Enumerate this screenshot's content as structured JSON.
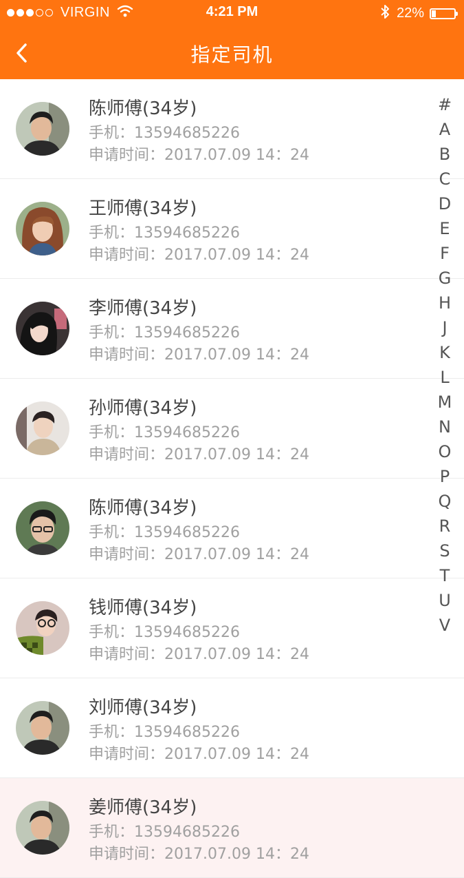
{
  "status_bar": {
    "carrier": "VIRGIN",
    "time": "4:21 PM",
    "battery": "22%",
    "battery_level": 0.22,
    "signal_dots_filled": 3,
    "signal_dots_total": 5
  },
  "nav": {
    "title": "指定司机",
    "back_icon": "chevron-left-icon"
  },
  "colors": {
    "header": "#ff7410",
    "name_text": "#444444",
    "meta_text": "#a0a0a0"
  },
  "drivers": [
    {
      "name": "陈师傅(34岁)",
      "phone": "手机：13594685226",
      "applied": "申请时间：2017.07.09  14：24"
    },
    {
      "name": "王师傅(34岁)",
      "phone": "手机：13594685226",
      "applied": "申请时间：2017.07.09  14：24"
    },
    {
      "name": "李师傅(34岁)",
      "phone": "手机：13594685226",
      "applied": "申请时间：2017.07.09  14：24"
    },
    {
      "name": "孙师傅(34岁)",
      "phone": "手机：13594685226",
      "applied": "申请时间：2017.07.09  14：24"
    },
    {
      "name": "陈师傅(34岁)",
      "phone": "手机：13594685226",
      "applied": "申请时间：2017.07.09  14：24"
    },
    {
      "name": "钱师傅(34岁)",
      "phone": "手机：13594685226",
      "applied": "申请时间：2017.07.09  14：24"
    },
    {
      "name": "刘师傅(34岁)",
      "phone": "手机：13594685226",
      "applied": "申请时间：2017.07.09  14：24"
    },
    {
      "name": "姜师傅(34岁)",
      "phone": "手机：13594685226",
      "applied": "申请时间：2017.07.09  14：24"
    }
  ],
  "index_letters": [
    "#",
    "A",
    "B",
    "C",
    "D",
    "E",
    "F",
    "G",
    "H",
    "J",
    "K",
    "L",
    "M",
    "N",
    "O",
    "P",
    "Q",
    "R",
    "S",
    "T",
    "U",
    "V"
  ]
}
